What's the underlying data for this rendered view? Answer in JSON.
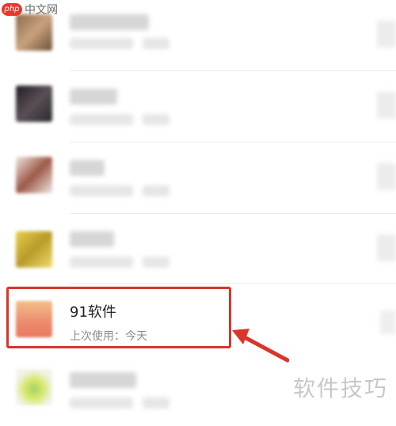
{
  "watermark_top": {
    "logo": "php",
    "text": "中文网"
  },
  "highlighted_item": {
    "name": "91软件",
    "subtitle": "上次使用：今天"
  },
  "watermark_bottom": "软件技巧",
  "colors": {
    "highlight_border": "#d9352b",
    "arrow": "#d9352b"
  }
}
